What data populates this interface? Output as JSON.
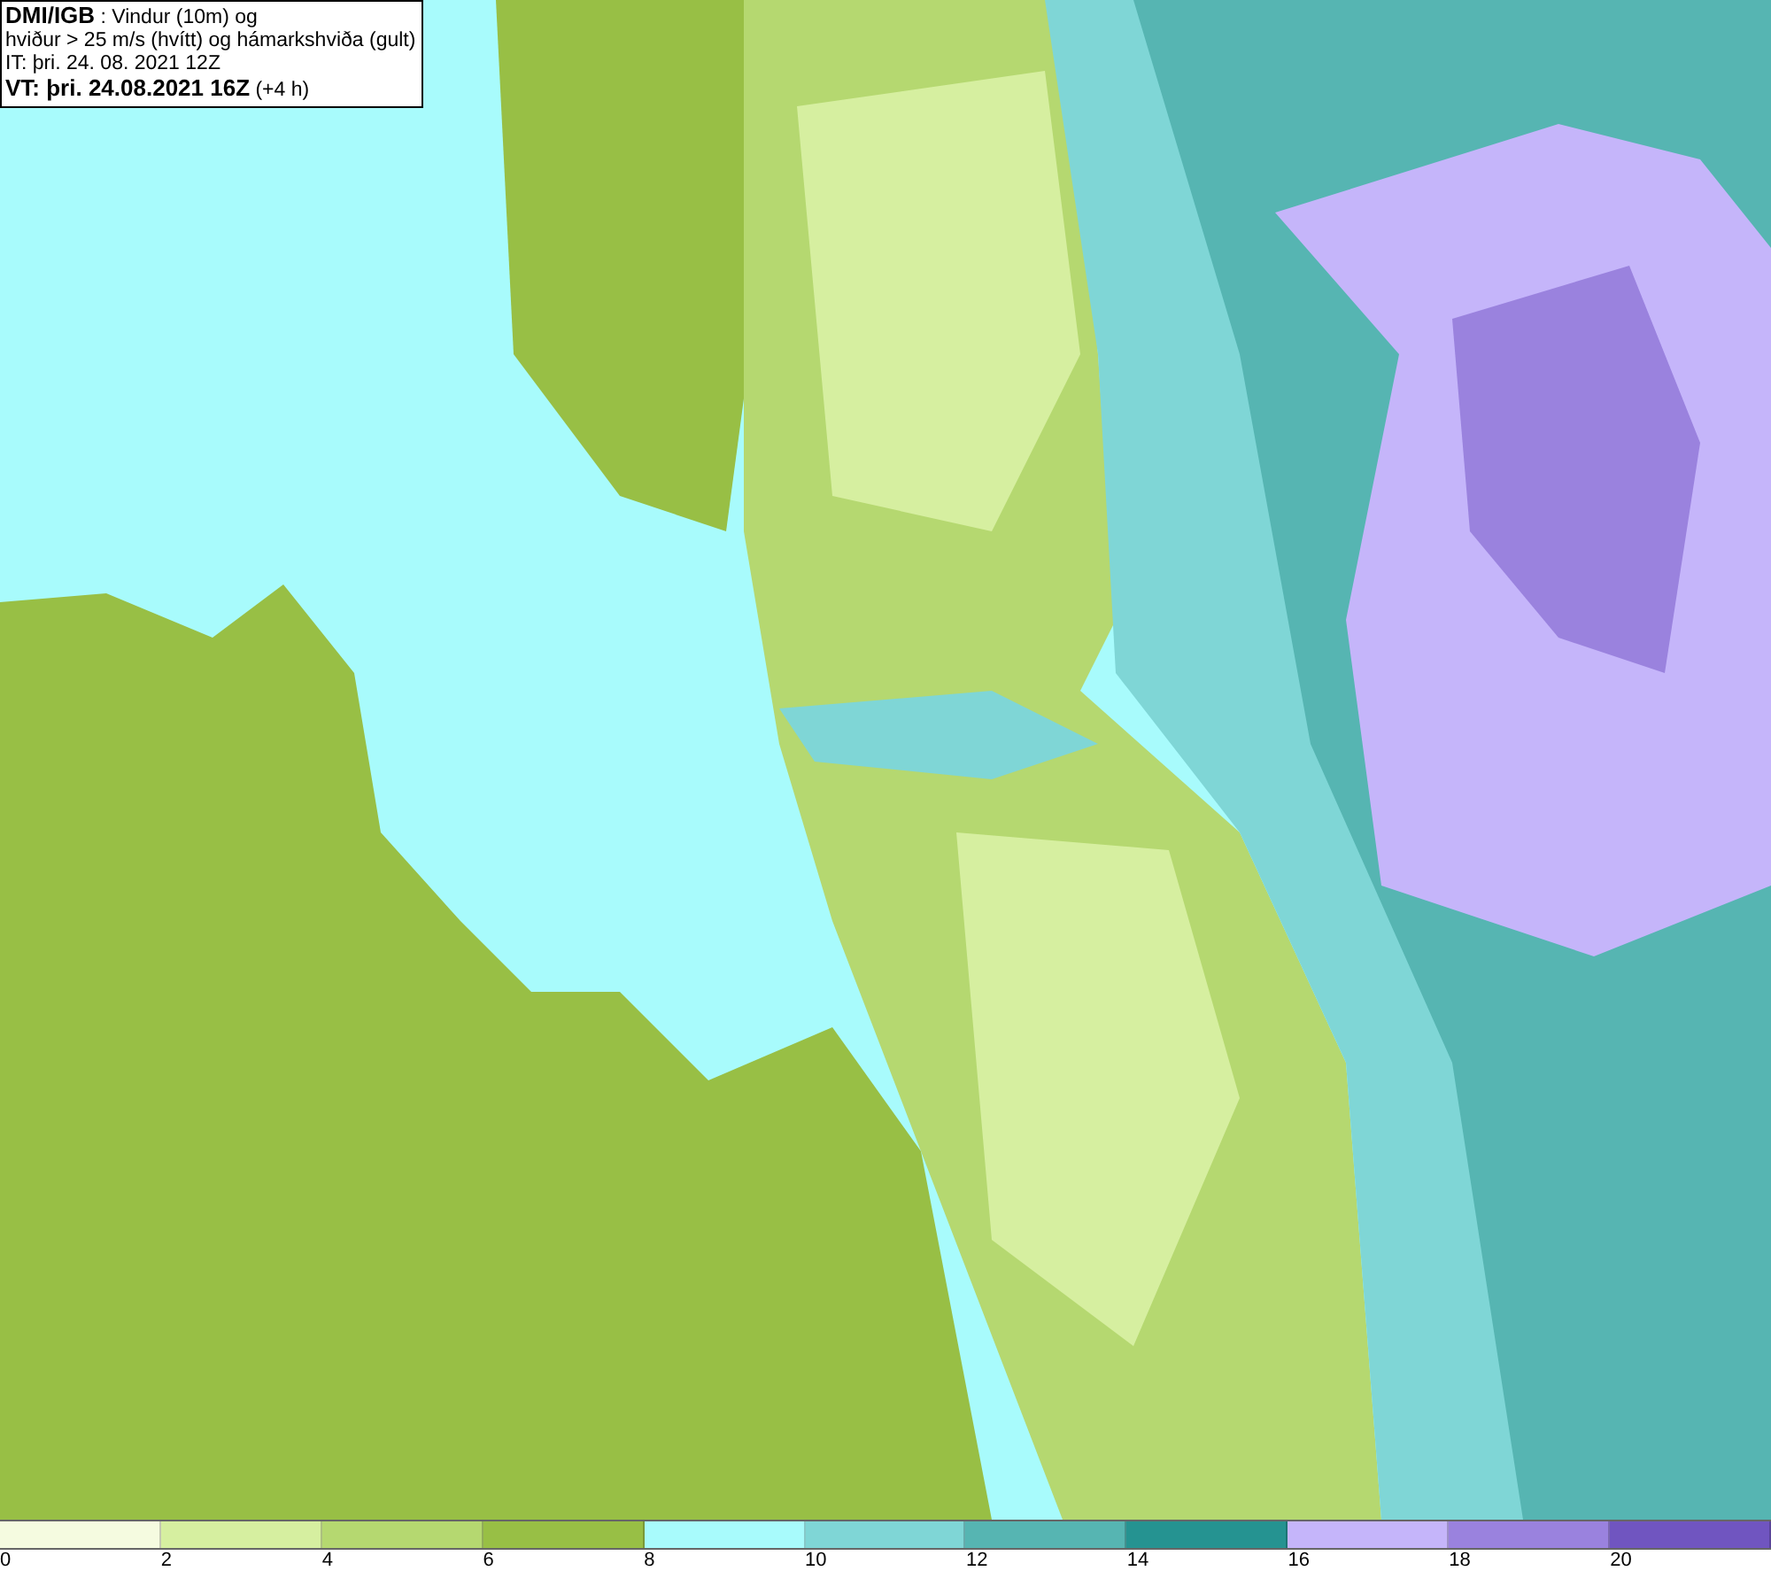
{
  "title_box": {
    "lines": [
      "**DMI/IGB** : Vindur (10m) og",
      "hviður > 25 m/s (hvítt) og hámarkshviða (gult)",
      "IT: þri. 24. 08. 2021 12Z",
      "**VT: þri. 24.08.2021 16Z** (+4 h)"
    ]
  },
  "legend": {
    "bins": [
      {
        "color": "#f5fbe0"
      },
      {
        "color": "#d6efa0"
      },
      {
        "color": "#b5d870"
      },
      {
        "color": "#98bf45"
      },
      {
        "color": "#a8fbfc"
      },
      {
        "color": "#7fd6d6"
      },
      {
        "color": "#56b5b2"
      },
      {
        "color": "#259391"
      },
      {
        "color": "#c5b5fa"
      },
      {
        "color": "#9a82de"
      },
      {
        "color": "#7055c0"
      }
    ],
    "ticks": [
      "0",
      "2",
      "4",
      "6",
      "8",
      "10",
      "12",
      "14",
      "16",
      "18",
      "20"
    ]
  }
}
